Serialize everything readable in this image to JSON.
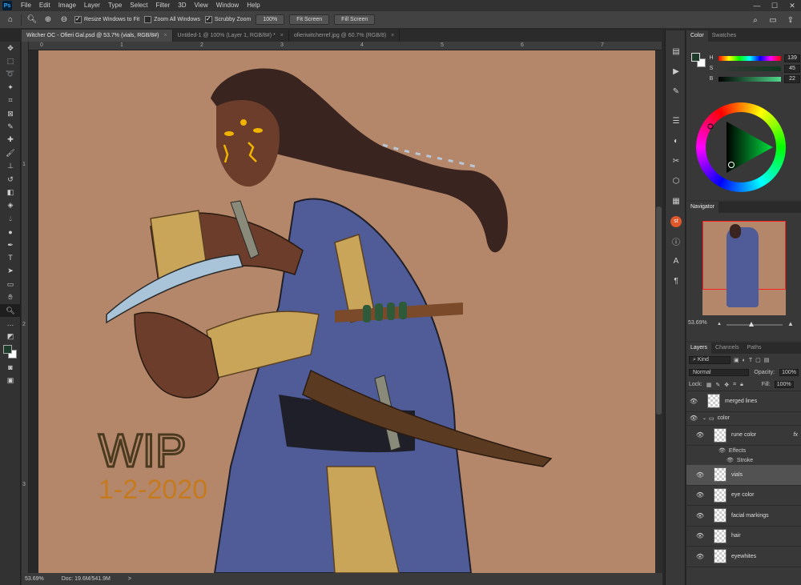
{
  "app": {
    "logo": "Ps"
  },
  "menu": [
    "File",
    "Edit",
    "Image",
    "Layer",
    "Type",
    "Select",
    "Filter",
    "3D",
    "View",
    "Window",
    "Help"
  ],
  "window_controls": {
    "minimize": "—",
    "maximize": "☐",
    "close": "✕"
  },
  "options": {
    "resize_windows": "Resize Windows to Fit",
    "zoom_all": "Zoom All Windows",
    "scrubby_zoom": "Scrubby Zoom",
    "zoom_100": "100%",
    "fit_screen": "Fit Screen",
    "fill_screen": "Fill Screen"
  },
  "tabs": [
    {
      "label": "Witcher OC - Ofieri Gal.psd @ 53.7% (vials, RGB/8#)",
      "close": "×"
    },
    {
      "label": "Untitled-1 @ 100% (Layer 1, RGB/8#) *",
      "close": "×"
    },
    {
      "label": "ofieriwitcherref.jpg @ 60.7% (RGB/8)",
      "close": "×"
    }
  ],
  "rulers": {
    "top": [
      "0",
      "1",
      "2",
      "3",
      "4",
      "5",
      "6",
      "7"
    ],
    "left": [
      "1",
      "2",
      "3"
    ]
  },
  "artwork": {
    "wip_text": "WIP",
    "date_text": "1-2-2020"
  },
  "status": {
    "zoom": "53.69%",
    "doc": "Doc: 19.6M/541.9M",
    "arrow": ">"
  },
  "color_panel": {
    "tabs": [
      "Color",
      "Swatches"
    ],
    "sliders": [
      {
        "label": "H",
        "value": "139",
        "unit": "°"
      },
      {
        "label": "S",
        "value": "45",
        "unit": "%"
      },
      {
        "label": "B",
        "value": "22",
        "unit": "%"
      }
    ],
    "foreground": "#1f3b2b",
    "background": "#ffffff"
  },
  "navigator": {
    "title": "Navigator",
    "zoom": "53.69%"
  },
  "layers_panel": {
    "tabs": [
      "Layers",
      "Channels",
      "Paths"
    ],
    "kind": "Kind",
    "blend": "Normal",
    "opacity_label": "Opacity:",
    "opacity": "100%",
    "lock_label": "Lock:",
    "fill_label": "Fill:",
    "fill": "100%",
    "effects_label": "Effects",
    "stroke_label": "Stroke",
    "fx": "fx",
    "layers": [
      {
        "name": "merged lines",
        "type": "layer"
      },
      {
        "name": "color",
        "type": "group"
      },
      {
        "name": "rune color",
        "type": "layer",
        "effects": true
      },
      {
        "name": "vials",
        "type": "layer",
        "selected": true
      },
      {
        "name": "eye color",
        "type": "layer"
      },
      {
        "name": "facial markings",
        "type": "layer"
      },
      {
        "name": "hair",
        "type": "layer"
      },
      {
        "name": "eyewhites",
        "type": "layer"
      }
    ]
  }
}
